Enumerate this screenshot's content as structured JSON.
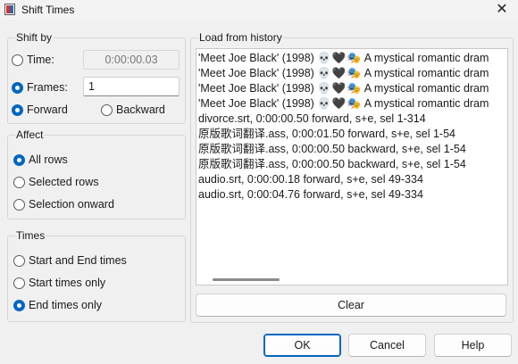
{
  "window": {
    "title": "Shift Times",
    "close_glyph": "✕"
  },
  "shift_by": {
    "title": "Shift by",
    "time_label": "Time:",
    "time_value": "0:00:00.03",
    "frames_label": "Frames:",
    "frames_value": "1",
    "selected": "frames",
    "forward_label": "Forward",
    "backward_label": "Backward",
    "direction": "forward"
  },
  "affect": {
    "title": "Affect",
    "options": [
      "All rows",
      "Selected rows",
      "Selection onward"
    ],
    "selected_index": 0
  },
  "times": {
    "title": "Times",
    "options": [
      "Start and End times",
      "Start times only",
      "End times only"
    ],
    "selected_index": 2
  },
  "history": {
    "title": "Load from history",
    "items": [
      {
        "text_a": "'Meet Joe Black' (1998) ",
        "icons": "💀🖤🎭",
        "text_b": "  A mystical romantic dram"
      },
      {
        "text_a": "'Meet Joe Black' (1998) ",
        "icons": "💀🖤🎭",
        "text_b": "  A mystical romantic dram"
      },
      {
        "text_a": "'Meet Joe Black' (1998) ",
        "icons": "💀🖤🎭",
        "text_b": "  A mystical romantic dram"
      },
      {
        "text_a": "'Meet Joe Black' (1998) ",
        "icons": "💀🖤🎭",
        "text_b": "  A mystical romantic dram"
      },
      {
        "text_a": "divorce.srt, 0:00:00.50 forward, s+e, sel 1-314",
        "icons": "",
        "text_b": ""
      },
      {
        "text_a": "原版歌词翻译.ass, 0:00:01.50 forward, s+e, sel 1-54",
        "icons": "",
        "text_b": ""
      },
      {
        "text_a": "原版歌词翻译.ass, 0:00:00.50 backward, s+e, sel 1-54",
        "icons": "",
        "text_b": ""
      },
      {
        "text_a": "原版歌词翻译.ass, 0:00:00.50 backward, s+e, sel 1-54",
        "icons": "",
        "text_b": ""
      },
      {
        "text_a": "audio.srt, 0:00:00.18 forward, s+e, sel 49-334",
        "icons": "",
        "text_b": ""
      },
      {
        "text_a": "audio.srt, 0:00:04.76 forward, s+e, sel 49-334",
        "icons": "",
        "text_b": ""
      }
    ],
    "clear_label": "Clear"
  },
  "buttons": {
    "ok": "OK",
    "cancel": "Cancel",
    "help": "Help"
  }
}
